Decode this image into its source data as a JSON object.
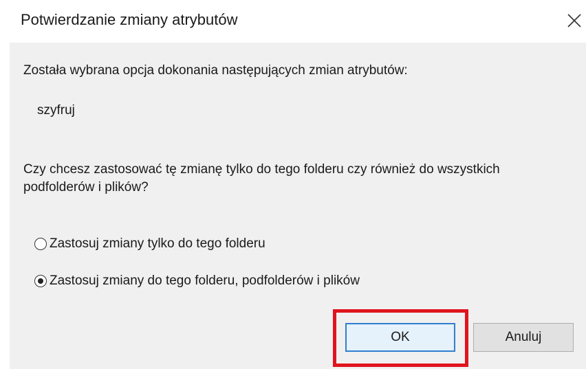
{
  "dialog": {
    "title": "Potwierdzanie zmiany atrybutów",
    "intro": "Została wybrana opcja dokonania następujących zmian atrybutów:",
    "attribute": "szyfruj",
    "question": "Czy chcesz zastosować tę zmianę tylko do tego folderu czy również do wszystkich podfolderów i plików?",
    "options": [
      {
        "label": "Zastosuj zmiany tylko do tego folderu",
        "selected": false
      },
      {
        "label": "Zastosuj zmiany do tego folderu, podfolderów i plików",
        "selected": true
      }
    ],
    "buttons": {
      "ok": "OK",
      "cancel": "Anuluj"
    },
    "icons": {
      "close": "close-icon"
    },
    "colors": {
      "highlight": "#e0141e",
      "focus_border": "#2f7fd0"
    }
  }
}
